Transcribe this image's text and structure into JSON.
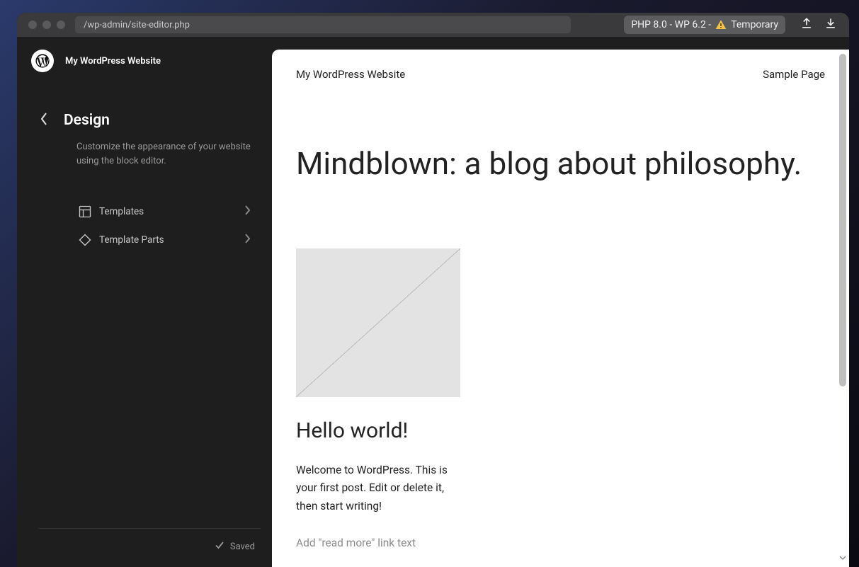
{
  "titlebar": {
    "url": "/wp-admin/site-editor.php",
    "badge_prefix": "PHP 8.0 - WP 6.2 -",
    "badge_suffix": "Temporary"
  },
  "sidebar": {
    "site_title": "My WordPress Website",
    "title": "Design",
    "description": "Customize the appearance of your website using the block editor.",
    "items": [
      {
        "label": "Templates"
      },
      {
        "label": "Template Parts"
      }
    ],
    "saved_label": "Saved"
  },
  "preview": {
    "site_title": "My WordPress Website",
    "nav_link": "Sample Page",
    "hero": "Mindblown: a blog about philosophy.",
    "post_title": "Hello world!",
    "post_body": "Welcome to WordPress. This is your first post. Edit or delete it, then start writing!",
    "read_more": "Add \"read more\" link text"
  }
}
